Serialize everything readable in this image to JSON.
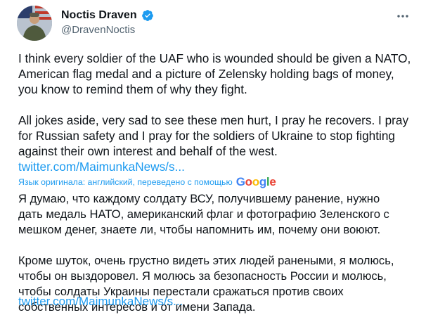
{
  "tweet": {
    "display_name": "Noctis Draven",
    "handle": "@DravenNoctis",
    "verified": true,
    "original_paragraph_1": [
      "I think every soldier of the UAF who is wounded should be given a NATO,",
      "American flag medal and a picture of Zelensky holding bags of money,",
      "you know to remind them of why they fight."
    ],
    "original_paragraph_2": [
      "All jokes aside, very sad to see these men hurt, I pray he recovers. I pray",
      "for Russian safety and I pray for the soldiers of Ukraine to stop fighting",
      "against their own interest and behalf of the west."
    ],
    "link_text": "twitter.com/MaimunkaNews/s...",
    "translation_note": "Язык оригинала: английский, переведено с помощью",
    "translation_provider": "Google",
    "translated_paragraph_1": [
      "Я думаю, что каждому солдату ВСУ, получившему ранение, нужно",
      "дать медаль НАТО, американский флаг и фотографию Зеленского с",
      "мешком денег, знаете ли, чтобы напомнить им, почему они воюют."
    ],
    "translated_paragraph_2": [
      "Кроме шуток, очень грустно видеть этих людей ранеными, я молюсь,",
      "чтобы он выздоровел. Я молюсь за безопасность России и молюсь,",
      "чтобы солдаты Украины перестали сражаться против своих",
      "собственных интересов и от имени Запада."
    ],
    "translated_link_text": "twitter.com/MaimunkaNews/s..."
  },
  "icons": {
    "verified": "verified-badge-icon",
    "more": "more-options-icon"
  },
  "colors": {
    "text": "#0f1419",
    "secondary": "#536471",
    "link": "#1d9bf0",
    "verified": "#1d9bf0"
  }
}
